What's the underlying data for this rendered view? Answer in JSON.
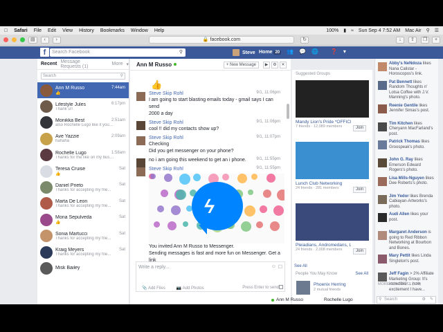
{
  "mac_menu": {
    "app": "Safari",
    "items": [
      "File",
      "Edit",
      "View",
      "History",
      "Bookmarks",
      "Window",
      "Help"
    ],
    "battery": "100%",
    "clock": "Sun Sep 4  7:52 AM",
    "device": "Mac Air"
  },
  "browser": {
    "url": "facebook.com"
  },
  "fb": {
    "search_placeholder": "Search Facebook",
    "user": "Steve",
    "home": "Home",
    "home_count": "20"
  },
  "left": {
    "tab_recent": "Recent",
    "tab_requests": "Message Requests (1)",
    "tab_more": "More",
    "search_placeholder": "Search",
    "conversations": [
      {
        "name": "Ann M Russo",
        "snippet": "👍",
        "time": "7:44am",
        "color": "#8a5a3c"
      },
      {
        "name": "Lifestyle Jules",
        "snippet": "Thank u!!",
        "time": "6:17pm",
        "color": "#6e5b4a"
      },
      {
        "name": "Monikka Best",
        "snippet": "also Rochelle Lugo like it you sent",
        "time": "2:51am",
        "color": "#33343a"
      },
      {
        "name": "Ave Yazzie",
        "snippet": "hahaha",
        "time": "2:09am",
        "color": "#c8a24a"
      },
      {
        "name": "Rochelle Lugo",
        "snippet": "Thanks for the like on my busine...",
        "time": "1:58am",
        "color": "#5b3a41"
      },
      {
        "name": "Teresa Cruise",
        "snippet": "👍",
        "time": "Sat",
        "color": "#d9dde3"
      },
      {
        "name": "Daniel Prieto",
        "snippet": "Thanks for accepting my frie...",
        "time": "Sat",
        "color": "#7b8a6a"
      },
      {
        "name": "Marta De Leon",
        "snippet": "Thanks for accepting my frie...",
        "time": "Sat",
        "color": "#b05a4a"
      },
      {
        "name": "Mona Sepulveda",
        "snippet": "👍",
        "time": "Sat",
        "color": "#9a4a8a"
      },
      {
        "name": "Sonia Martucci",
        "snippet": "Thanks for accepting my frie...",
        "time": "Sat",
        "color": "#c4936a"
      },
      {
        "name": "Kraig Meyers",
        "snippet": "Thanks for accepting my frie...",
        "time": "Sat",
        "color": "#2c3a5a"
      },
      {
        "name": "Misk Bailey",
        "snippet": "",
        "time": "",
        "color": "#5a5a5a"
      }
    ]
  },
  "chat": {
    "title": "Ann M Russo",
    "new_message": "+ New Message",
    "messages": [
      {
        "who": "Steve Skip Rohl",
        "time": "9/1, 11:06pm",
        "lines": [
          "I am going to start blasting emails today - gmail says I can send",
          "2000 a day"
        ],
        "pic": "#8b6b56"
      },
      {
        "who": "Steve Skip Rohl",
        "time": "9/1, 11:06pm",
        "lines": [
          "cool !! did my contacts show up?"
        ],
        "pic": "#5a4636"
      },
      {
        "who": "Steve Skip Rohl",
        "time": "9/1, 11:07pm",
        "lines": [
          "Checking",
          "Did you get messenger on your phone?"
        ],
        "pic": "#8b6b56"
      },
      {
        "who": "",
        "time": "9/1, 11:55pm",
        "lines": [
          "no i am going this weekend to get an i phone."
        ],
        "pic": "#5a4636"
      },
      {
        "who": "Steve Skip Rohl",
        "time": "9/1, 11:55pm",
        "lines": [],
        "pic": "#8b6b56"
      }
    ],
    "invite_line1": "You invited Ann M Russo to Messenger.",
    "invite_line2": "Sending messages is fast and more fun on Messenger. Get a link",
    "composer_placeholder": "Write a reply...",
    "add_files": "Add Files",
    "add_photos": "Add Photos",
    "press_enter": "Press Enter to send"
  },
  "groups": {
    "heading": "Suggested Groups",
    "items": [
      {
        "name": "Mandy Lion's Pride *OFFICIAL*",
        "members": "7 friends · 12,089 members",
        "join": "Join",
        "img": "#222"
      },
      {
        "name": "Lunch Club Networking",
        "members": "24 friends · 281 members",
        "join": "Join",
        "img": "#3a8fd0"
      },
      {
        "name": "Pleiadians, Andromedans, Lyrans, Sirians, Tran...",
        "members": "24 friends · 2,008 members",
        "join": "Join",
        "img": "#3a4a7a"
      }
    ],
    "see_all": "See All"
  },
  "pymk": {
    "heading": "People You May Know",
    "see_all": "See All",
    "person": "Phoenix Herring",
    "mutual": "2 mutual friends"
  },
  "chatbar": {
    "a": "Ann M Russo",
    "b": "Rochelle Lugo"
  },
  "ticker": {
    "items": [
      {
        "name": "Abby's NeNdoza",
        "text": "likes Nana Calistar - Horoscopos's link.",
        "pic": "#c08a6a"
      },
      {
        "name": "Pat Bennett",
        "text": "likes Random Thoughts n' Lotsa Coffee with J.V. Manning's photo.",
        "pic": "#5a6a8a"
      },
      {
        "name": "Reenie Gentile",
        "text": "likes Jennifer Simas's post.",
        "pic": "#8a5a4a"
      },
      {
        "name": "Tim Kitchen",
        "text": "likes Cheryann MacFarland's post.",
        "pic": "#4a4a4a"
      },
      {
        "name": "Patrick Thomas",
        "text": "likes Groospeak's photo.",
        "pic": "#6a7a9a"
      },
      {
        "name": "John G. Ray",
        "text": "likes Emerson Edward Rogers's photo.",
        "pic": "#5a4a3a"
      },
      {
        "name": "Lisa Mills-Nguyen",
        "text": "likes Dee Roberts's photo.",
        "pic": "#9a6a5a"
      },
      {
        "name": "Jim Yedor",
        "text": "likes Brenda Cabiayan-Artworks's photo.",
        "pic": "#7a6a5a"
      },
      {
        "name": "Audi Allen",
        "text": "likes your post.",
        "pic": "#2a2a2a"
      },
      {
        "name": "Margaret Anderson",
        "text": "is going to Red Ribbon Networking at Bourbon and Bones.",
        "pic": "#b08a7a"
      },
      {
        "name": "Mary Pettit",
        "text": "likes Linda Singleton's post.",
        "pic": "#8a5a6a"
      },
      {
        "name": "Jeff Fagin",
        "text": "> 2% Affiliate Marketing Group: It's incredible ... how excitement I have...",
        "pic": "#5a5a5a"
      }
    ],
    "more_contacts": "MORE CONTACTS (122)",
    "search_placeholder": "Search"
  }
}
